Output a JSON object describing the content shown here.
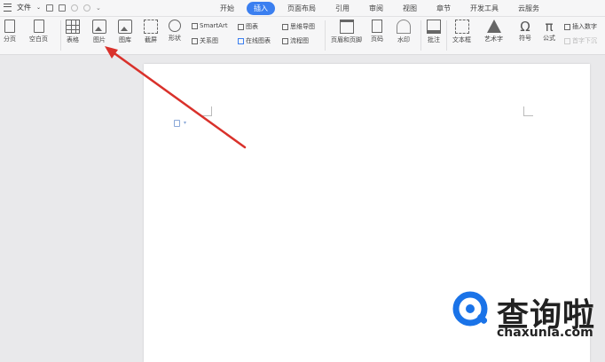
{
  "topbar": {
    "file_label": "文件",
    "tabs": [
      "开始",
      "插入",
      "页面布局",
      "引用",
      "审阅",
      "视图",
      "章节",
      "开发工具",
      "云服务"
    ],
    "active_tab": "插入"
  },
  "ribbon": {
    "page_break": "分页",
    "blank_page": "空白页",
    "table": "表格",
    "picture": "图片",
    "gallery": "图库",
    "screenshot": "截屏",
    "shape": "形状",
    "smartart": "SmartArt",
    "relation": "关系图",
    "chart": "图表",
    "online_chart": "在线图表",
    "mindmap": "思维导图",
    "flowchart": "流程图",
    "header_footer": "页眉和页脚",
    "page_number": "页码",
    "watermark": "水印",
    "comment": "批注",
    "textbox": "文本框",
    "wordart": "艺术字",
    "symbol": "符号",
    "formula": "公式",
    "insert_number": "插入数字",
    "first_letter": "首字下沉",
    "symbol_glyph": "Ω",
    "formula_glyph": "π"
  },
  "watermark_brand": {
    "name": "查询啦",
    "url": "chaxunla.com",
    "color": "#1a73e8"
  },
  "accent_color": "#3b7ff0",
  "arrow_color": "#d9312b"
}
